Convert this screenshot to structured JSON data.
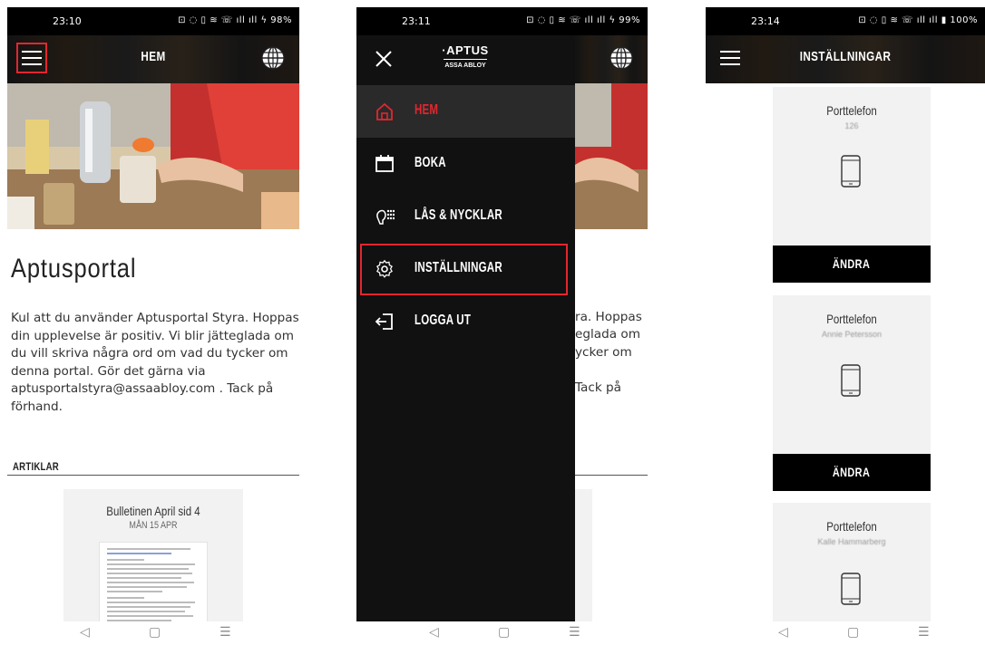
{
  "screen1": {
    "status": {
      "time": "23:10",
      "icons": "⊡ ◌ ▯ ≋ ☏ ıll ıll ϟ 98%"
    },
    "topbar": {
      "title": "HEM",
      "menu_icon": "hamburger-icon",
      "globe_icon": "globe-icon"
    },
    "heading": "Aptusportal",
    "intro_lines": [
      "Kul att du använder Aptusportal Styra. Hoppas",
      "din upplevelse är positiv. Vi blir jätteglada om",
      "du vill skriva några ord om vad du tycker om",
      "denna portal. Gör det gärna via",
      "aptusportalstyra@assaabloy.com . Tack på",
      "förhand."
    ],
    "section_title": "ARTIKLAR",
    "article": {
      "title": "Bulletinen April sid 4",
      "date": "MÅN 15 APR"
    }
  },
  "screen2": {
    "status": {
      "time": "23:11",
      "icons": "⊡ ◌ ▯ ≋ ☏ ıll ıll ϟ 99%"
    },
    "logo": {
      "line1": "·APTUS",
      "line2": "ASSA ABLOY"
    },
    "menu": [
      {
        "label": "HEM",
        "icon": "home-icon",
        "active": true
      },
      {
        "label": "BOKA",
        "icon": "calendar-icon",
        "active": false
      },
      {
        "label": "LÅS & NYCKLAR",
        "icon": "key-icon",
        "active": false
      },
      {
        "label": "INSTÄLLNINGAR",
        "icon": "gear-icon",
        "active": false
      },
      {
        "label": "LOGGA UT",
        "icon": "logout-icon",
        "active": false
      }
    ],
    "behind_text": [
      "ra. Hoppas",
      "eglada om",
      "ycker om",
      "Tack på"
    ]
  },
  "screen3": {
    "status": {
      "time": "23:14",
      "icons": "⊡ ◌ ▯ ≋ ☏ ıll ıll ▮ 100%"
    },
    "topbar": {
      "title": "INSTÄLLNINGAR"
    },
    "cards": [
      {
        "title": "Porttelefon",
        "subtitle": "126",
        "button": "ÄNDRA"
      },
      {
        "title": "Porttelefon",
        "subtitle": "Annie Petersson",
        "button": "ÄNDRA"
      },
      {
        "title": "Porttelefon",
        "subtitle": "Kalle Hammarberg"
      }
    ]
  },
  "colors": {
    "accent": "#e3262f",
    "drawer": "#111111",
    "button": "#000000"
  }
}
